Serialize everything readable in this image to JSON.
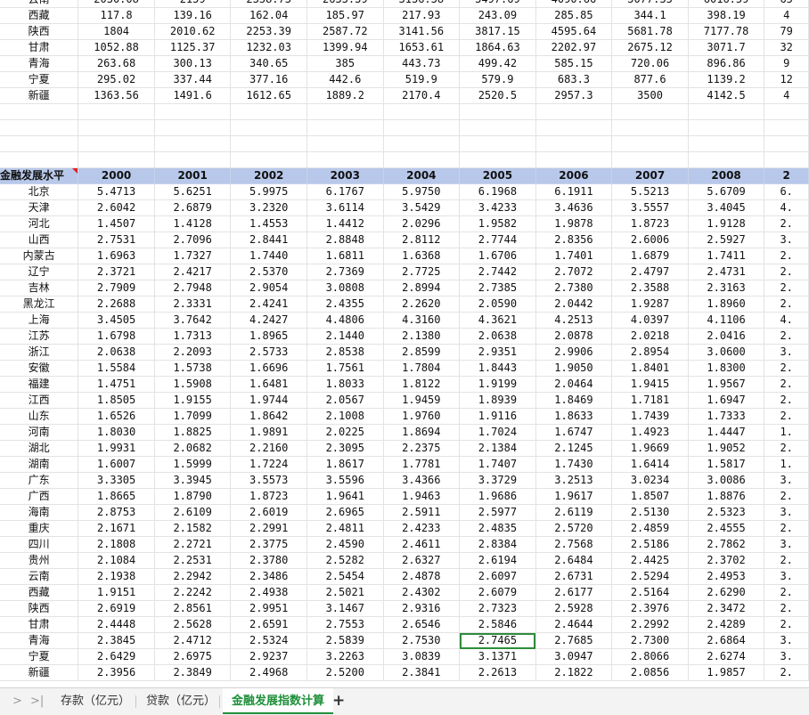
{
  "top_rows": [
    [
      "云南",
      "2030.08",
      "2159",
      "2358.73",
      "2633.39",
      "3136.38",
      "3497.69",
      "4090.66",
      "5077.35",
      "6016.59",
      "65"
    ],
    [
      "西藏",
      "117.8",
      "139.16",
      "162.04",
      "185.97",
      "217.93",
      "243.09",
      "285.85",
      "344.1",
      "398.19",
      "4"
    ],
    [
      "陕西",
      "1804",
      "2010.62",
      "2253.39",
      "2587.72",
      "3141.56",
      "3817.15",
      "4595.64",
      "5681.78",
      "7177.78",
      "79"
    ],
    [
      "甘肃",
      "1052.88",
      "1125.37",
      "1232.03",
      "1399.94",
      "1653.61",
      "1864.63",
      "2202.97",
      "2675.12",
      "3071.7",
      "32"
    ],
    [
      "青海",
      "263.68",
      "300.13",
      "340.65",
      "385",
      "443.73",
      "499.42",
      "585.15",
      "720.06",
      "896.86",
      "9"
    ],
    [
      "宁夏",
      "295.02",
      "337.44",
      "377.16",
      "442.6",
      "519.9",
      "579.9",
      "683.3",
      "877.6",
      "1139.2",
      "12"
    ],
    [
      "新疆",
      "1363.56",
      "1491.6",
      "1612.65",
      "1889.2",
      "2170.4",
      "2520.5",
      "2957.3",
      "3500",
      "4142.5",
      "4"
    ]
  ],
  "header": [
    "金融发展水平",
    "2000",
    "2001",
    "2002",
    "2003",
    "2004",
    "2005",
    "2006",
    "2007",
    "2008",
    "2"
  ],
  "rows": [
    [
      "北京",
      "5.4713",
      "5.6251",
      "5.9975",
      "6.1767",
      "5.9750",
      "6.1968",
      "6.1911",
      "5.5213",
      "5.6709",
      "6."
    ],
    [
      "天津",
      "2.6042",
      "2.6879",
      "3.2320",
      "3.6114",
      "3.5429",
      "3.4233",
      "3.4636",
      "3.5557",
      "3.4045",
      "4."
    ],
    [
      "河北",
      "1.4507",
      "1.4128",
      "1.4553",
      "1.4412",
      "2.0296",
      "1.9582",
      "1.9878",
      "1.8723",
      "1.9128",
      "2."
    ],
    [
      "山西",
      "2.7531",
      "2.7096",
      "2.8441",
      "2.8848",
      "2.8112",
      "2.7744",
      "2.8356",
      "2.6006",
      "2.5927",
      "3."
    ],
    [
      "内蒙古",
      "1.6963",
      "1.7327",
      "1.7440",
      "1.6811",
      "1.6368",
      "1.6706",
      "1.7401",
      "1.6879",
      "1.7411",
      "2."
    ],
    [
      "辽宁",
      "2.3721",
      "2.4217",
      "2.5370",
      "2.7369",
      "2.7725",
      "2.7442",
      "2.7072",
      "2.4797",
      "2.4731",
      "2."
    ],
    [
      "吉林",
      "2.7909",
      "2.7948",
      "2.9054",
      "3.0808",
      "2.8994",
      "2.7385",
      "2.7380",
      "2.3588",
      "2.3163",
      "2."
    ],
    [
      "黑龙江",
      "2.2688",
      "2.3331",
      "2.4241",
      "2.4355",
      "2.2620",
      "2.0590",
      "2.0442",
      "1.9287",
      "1.8960",
      "2."
    ],
    [
      "上海",
      "3.4505",
      "3.7642",
      "4.2427",
      "4.4806",
      "4.3160",
      "4.3621",
      "4.2513",
      "4.0397",
      "4.1106",
      "4."
    ],
    [
      "江苏",
      "1.6798",
      "1.7313",
      "1.8965",
      "2.1440",
      "2.1380",
      "2.0638",
      "2.0878",
      "2.0218",
      "2.0416",
      "2."
    ],
    [
      "浙江",
      "2.0638",
      "2.2093",
      "2.5733",
      "2.8538",
      "2.8599",
      "2.9351",
      "2.9906",
      "2.8954",
      "3.0600",
      "3."
    ],
    [
      "安徽",
      "1.5584",
      "1.5738",
      "1.6696",
      "1.7561",
      "1.7804",
      "1.8443",
      "1.9050",
      "1.8401",
      "1.8300",
      "2."
    ],
    [
      "福建",
      "1.4751",
      "1.5908",
      "1.6481",
      "1.8033",
      "1.8122",
      "1.9199",
      "2.0464",
      "1.9415",
      "1.9567",
      "2."
    ],
    [
      "江西",
      "1.8505",
      "1.9155",
      "1.9744",
      "2.0567",
      "1.9459",
      "1.8939",
      "1.8469",
      "1.7181",
      "1.6947",
      "2."
    ],
    [
      "山东",
      "1.6526",
      "1.7099",
      "1.8642",
      "2.1008",
      "1.9760",
      "1.9116",
      "1.8633",
      "1.7439",
      "1.7333",
      "2."
    ],
    [
      "河南",
      "1.8030",
      "1.8825",
      "1.9891",
      "2.0225",
      "1.8694",
      "1.7024",
      "1.6747",
      "1.4923",
      "1.4447",
      "1."
    ],
    [
      "湖北",
      "1.9931",
      "2.0682",
      "2.2160",
      "2.3095",
      "2.2375",
      "2.1384",
      "2.1245",
      "1.9669",
      "1.9052",
      "2."
    ],
    [
      "湖南",
      "1.6007",
      "1.5999",
      "1.7224",
      "1.8617",
      "1.7781",
      "1.7407",
      "1.7430",
      "1.6414",
      "1.5817",
      "1."
    ],
    [
      "广东",
      "3.3305",
      "3.3945",
      "3.5573",
      "3.5596",
      "3.4366",
      "3.3729",
      "3.2513",
      "3.0234",
      "3.0086",
      "3."
    ],
    [
      "广西",
      "1.8665",
      "1.8790",
      "1.8723",
      "1.9641",
      "1.9463",
      "1.9686",
      "1.9617",
      "1.8507",
      "1.8876",
      "2."
    ],
    [
      "海南",
      "2.8753",
      "2.6109",
      "2.6019",
      "2.6965",
      "2.5911",
      "2.5977",
      "2.6119",
      "2.5130",
      "2.5323",
      "3."
    ],
    [
      "重庆",
      "2.1671",
      "2.1582",
      "2.2991",
      "2.4811",
      "2.4233",
      "2.4835",
      "2.5720",
      "2.4859",
      "2.4555",
      "2."
    ],
    [
      "四川",
      "2.1808",
      "2.2721",
      "2.3775",
      "2.4590",
      "2.4611",
      "2.8384",
      "2.7568",
      "2.5186",
      "2.7862",
      "3."
    ],
    [
      "贵州",
      "2.1084",
      "2.2531",
      "2.3780",
      "2.5282",
      "2.6327",
      "2.6194",
      "2.6484",
      "2.4425",
      "2.3702",
      "2."
    ],
    [
      "云南",
      "2.1938",
      "2.2942",
      "2.3486",
      "2.5454",
      "2.4878",
      "2.6097",
      "2.6731",
      "2.5294",
      "2.4953",
      "3."
    ],
    [
      "西藏",
      "1.9151",
      "2.2242",
      "2.4938",
      "2.5021",
      "2.4302",
      "2.6079",
      "2.6177",
      "2.5164",
      "2.6290",
      "2."
    ],
    [
      "陕西",
      "2.6919",
      "2.8561",
      "2.9951",
      "3.1467",
      "2.9316",
      "2.7323",
      "2.5928",
      "2.3976",
      "2.3472",
      "2."
    ],
    [
      "甘肃",
      "2.4448",
      "2.5628",
      "2.6591",
      "2.7553",
      "2.6546",
      "2.5846",
      "2.4644",
      "2.2992",
      "2.4289",
      "2."
    ],
    [
      "青海",
      "2.3845",
      "2.4712",
      "2.5324",
      "2.5839",
      "2.7530",
      "2.7465",
      "2.7685",
      "2.7300",
      "2.6864",
      "3."
    ],
    [
      "宁夏",
      "2.6429",
      "2.6975",
      "2.9237",
      "3.2263",
      "3.0839",
      "3.1371",
      "3.0947",
      "2.8066",
      "2.6274",
      "3."
    ],
    [
      "新疆",
      "2.3956",
      "2.3849",
      "2.4968",
      "2.5200",
      "2.3841",
      "2.2613",
      "2.1822",
      "2.0856",
      "1.9857",
      "2."
    ]
  ],
  "selected_cell": {
    "row": 28,
    "col": 6
  },
  "sheet_tabs": [
    "存款（亿元）",
    "贷款（亿元）",
    "金融发展指数计算"
  ],
  "active_tab": 2,
  "nav_icons": [
    "chevron-right-icon",
    "last-sheet-icon"
  ],
  "add_sheet_label": "+",
  "colors": {
    "header_bg": "#b8c8ea",
    "selection": "#2e8b3a",
    "active_tab": "#1f8f3a"
  }
}
